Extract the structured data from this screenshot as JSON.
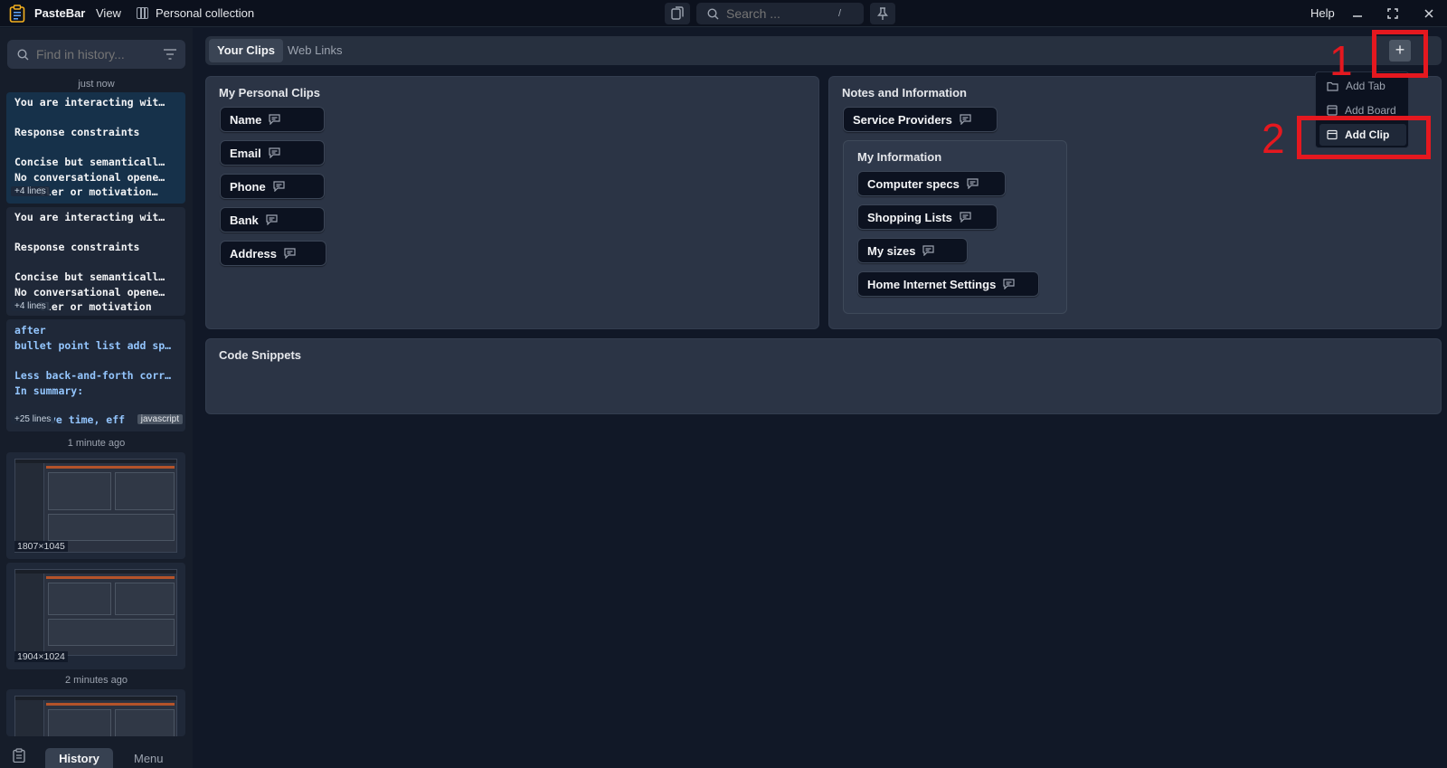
{
  "titlebar": {
    "app_name": "PasteBar",
    "view_menu": "View",
    "collection": "Personal collection",
    "search_placeholder": "Search ...",
    "search_shortcut": "/",
    "help": "Help"
  },
  "sidebar": {
    "search_placeholder": "Find in history...",
    "groups": [
      {
        "label": "just now"
      },
      {
        "label": "1 minute ago"
      },
      {
        "label": "2 minutes ago"
      }
    ],
    "clips": [
      {
        "lines": [
          "You are interacting wit…",
          "",
          "Response constraints",
          "",
          "Concise but semanticall…",
          "No conversational opene…",
          "ller or motivation…"
        ],
        "more": "+4 lines"
      },
      {
        "lines": [
          "You are interacting wit…",
          "",
          "Response constraints",
          "",
          "Concise but semanticall…",
          "No conversational opene…",
          "ller or motivation"
        ],
        "more": "+4 lines"
      },
      {
        "lines": [
          "after",
          "bullet point list add sp…",
          "",
          "Less back-and-forth corr…",
          "In summary:",
          "",
          "ve time, eff"
        ],
        "more": "+25 lines",
        "lang": "javascript"
      }
    ],
    "images": [
      {
        "dims": "1807×1045"
      },
      {
        "dims": "1904×1024"
      }
    ],
    "bottom_tabs": {
      "history": "History",
      "menu": "Menu"
    }
  },
  "main": {
    "tabs": [
      {
        "label": "Your Clips"
      },
      {
        "label": "Web Links"
      }
    ],
    "add_label": "+",
    "boards": {
      "personal": {
        "title": "My Personal Clips",
        "clips": [
          "Name",
          "Email",
          "Phone",
          "Bank",
          "Address"
        ]
      },
      "notes": {
        "title": "Notes and Information",
        "clips": [
          "Service Providers"
        ],
        "sub_board": {
          "title": "My Information",
          "clips": [
            "Computer specs",
            "Shopping Lists",
            "My sizes",
            "Home Internet Settings"
          ]
        }
      },
      "code": {
        "title": "Code Snippets"
      }
    },
    "dropdown": {
      "items": [
        "Add Tab",
        "Add Board",
        "Add Clip"
      ]
    }
  },
  "annotations": {
    "step1": "1",
    "step2": "2",
    "color": "#e5181f"
  }
}
